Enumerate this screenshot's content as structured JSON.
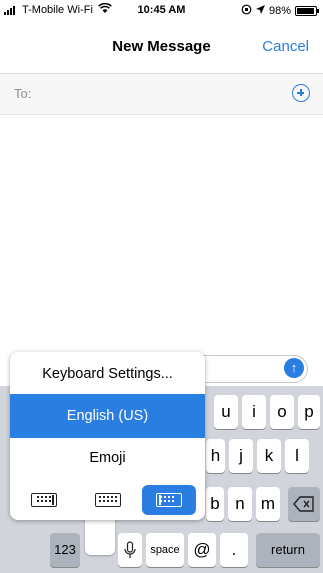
{
  "status": {
    "carrier": "T-Mobile Wi-Fi",
    "time": "10:45 AM",
    "battery": "98%"
  },
  "nav": {
    "title": "New Message",
    "cancel": "Cancel"
  },
  "to": {
    "label": "To:"
  },
  "popup": {
    "settings": "Keyboard Settings...",
    "english": "English (US)",
    "emoji": "Emoji",
    "layout_icons": [
      "keyboard-left-icon",
      "keyboard-full-icon",
      "keyboard-right-icon"
    ]
  },
  "keyboard": {
    "row1_visible": [
      "i",
      "o",
      "p"
    ],
    "row2_visible": [
      "h",
      "j",
      "k",
      "l"
    ],
    "row3_visible": [
      "m"
    ],
    "numbers": "123",
    "space": "space",
    "at": "@",
    "dot": ".",
    "return": "return"
  },
  "colors": {
    "accent": "#2a7de1",
    "keyboard_bg": "#d1d4da",
    "dark_key": "#adb3bc"
  }
}
